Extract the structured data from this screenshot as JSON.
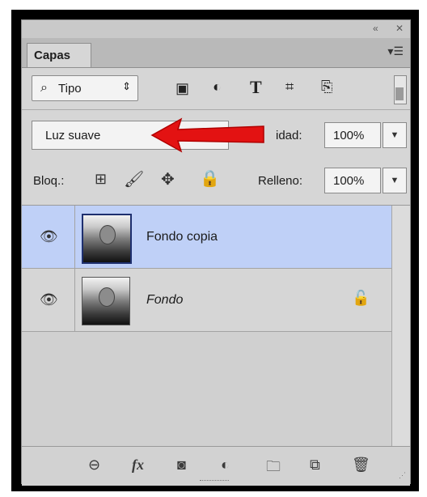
{
  "panel": {
    "title_tab": "Capas",
    "collapse_icon": "double-left-arrow-icon",
    "close_icon": "close-icon",
    "menu_icon": "panel-menu-icon"
  },
  "filter": {
    "kind_label": "Tipo",
    "icons": [
      "image-filter-icon",
      "adjustment-filter-icon",
      "type-filter-icon",
      "shape-filter-icon",
      "smart-object-filter-icon"
    ]
  },
  "blend": {
    "mode_value": "Luz suave",
    "opacity_label": "idad:",
    "opacity_value": "100%"
  },
  "lock": {
    "label": "Bloq.:",
    "fill_label": "Relleno:",
    "fill_value": "100%"
  },
  "layers": [
    {
      "name": "Fondo copia",
      "selected": true
    },
    {
      "name": "Fondo",
      "selected": false,
      "locked": true
    }
  ],
  "colors": {
    "selected_row": "#bfd0f7",
    "arrow": "#e31212"
  }
}
